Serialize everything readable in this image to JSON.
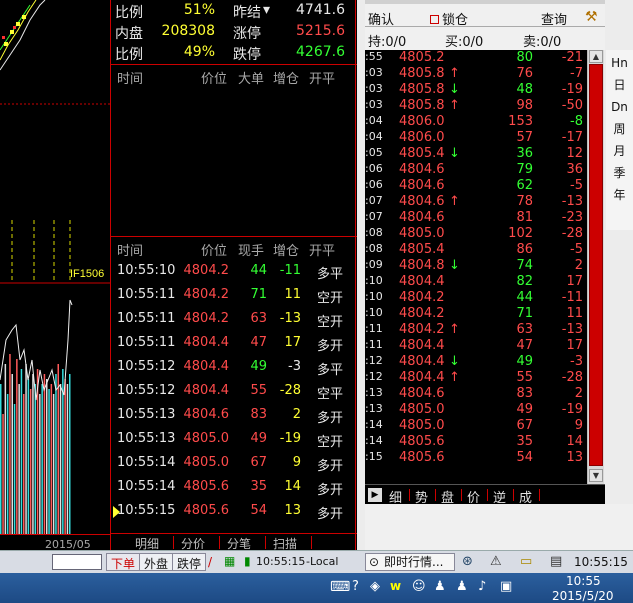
{
  "stats": [
    {
      "label": "比例",
      "value": "51%",
      "label2": "昨结",
      "value2": "4741.6",
      "v2color": "white",
      "arrow": "▾"
    },
    {
      "label": "内盘",
      "value": "208308",
      "label2": "涨停",
      "value2": "5215.6",
      "v2color": "red",
      "arrow": ""
    },
    {
      "label": "比例",
      "value": "49%",
      "label2": "跌停",
      "value2": "4267.6",
      "v2color": "green",
      "arrow": ""
    }
  ],
  "bigorder_header": {
    "time": "时间",
    "price": "价位",
    "big": "大单",
    "oi": "增仓",
    "kind": "开平"
  },
  "trades_header": {
    "time": "时间",
    "price": "价位",
    "vol": "现手",
    "oi": "增仓",
    "kind": "开平"
  },
  "trades": [
    {
      "time": "10:55:10",
      "price": "4804.2",
      "vol": "44",
      "oi": "-11",
      "kind": "多平",
      "pc": "red",
      "vc": "green",
      "oc": "green",
      "kc": "white"
    },
    {
      "time": "10:55:11",
      "price": "4804.2",
      "vol": "71",
      "oi": "11",
      "kind": "空开",
      "pc": "red",
      "vc": "green",
      "oc": "yellow",
      "kc": "white"
    },
    {
      "time": "10:55:11",
      "price": "4804.2",
      "vol": "63",
      "oi": "-13",
      "kind": "空开",
      "pc": "red",
      "vc": "red",
      "oc": "yellow",
      "kc": "white"
    },
    {
      "time": "10:55:11",
      "price": "4804.4",
      "vol": "47",
      "oi": "17",
      "kind": "多开",
      "pc": "red",
      "vc": "red",
      "oc": "yellow",
      "kc": "white"
    },
    {
      "time": "10:55:12",
      "price": "4804.4",
      "vol": "49",
      "oi": "-3",
      "kind": "多平",
      "pc": "red",
      "vc": "green",
      "oc": "white",
      "kc": "white"
    },
    {
      "time": "10:55:12",
      "price": "4804.4",
      "vol": "55",
      "oi": "-28",
      "kind": "空平",
      "pc": "red",
      "vc": "red",
      "oc": "yellow",
      "kc": "white"
    },
    {
      "time": "10:55:13",
      "price": "4804.6",
      "vol": "83",
      "oi": "2",
      "kind": "多开",
      "pc": "red",
      "vc": "red",
      "oc": "yellow",
      "kc": "white"
    },
    {
      "time": "10:55:13",
      "price": "4805.0",
      "vol": "49",
      "oi": "-19",
      "kind": "空开",
      "pc": "red",
      "vc": "red",
      "oc": "yellow",
      "kc": "white"
    },
    {
      "time": "10:55:14",
      "price": "4805.0",
      "vol": "67",
      "oi": "9",
      "kind": "多开",
      "pc": "red",
      "vc": "red",
      "oc": "yellow",
      "kc": "white"
    },
    {
      "time": "10:55:14",
      "price": "4805.6",
      "vol": "35",
      "oi": "14",
      "kind": "多开",
      "pc": "red",
      "vc": "red",
      "oc": "yellow",
      "kc": "white"
    },
    {
      "time": "10:55:15",
      "price": "4805.6",
      "vol": "54",
      "oi": "13",
      "kind": "多开",
      "pc": "red",
      "vc": "red",
      "oc": "yellow",
      "kc": "white"
    }
  ],
  "mid_tabs": [
    "明细",
    "分价",
    "分笔",
    "扫描"
  ],
  "chart": {
    "contract": "IF1506",
    "date": "2015/05"
  },
  "trade_panel": {
    "confirm": "确认",
    "lock": "锁仓",
    "query": "查询",
    "hold": "持:0/0",
    "buy": "买:0/0",
    "sell": "卖:0/0"
  },
  "ticks": [
    {
      "t": ":55",
      "p": "4805.2",
      "a": "",
      "v": "80",
      "o": "-21",
      "vc": "green",
      "oc": "red"
    },
    {
      "t": ":03",
      "p": "4805.8",
      "a": "↑",
      "v": "76",
      "o": "-7",
      "vc": "red",
      "oc": "red"
    },
    {
      "t": ":03",
      "p": "4805.8",
      "a": "↓",
      "v": "48",
      "o": "-19",
      "vc": "green",
      "oc": "red"
    },
    {
      "t": ":03",
      "p": "4805.8",
      "a": "↑",
      "v": "98",
      "o": "-50",
      "vc": "red",
      "oc": "red"
    },
    {
      "t": ":04",
      "p": "4806.0",
      "a": "",
      "v": "153",
      "o": "-8",
      "vc": "red",
      "oc": "green"
    },
    {
      "t": ":04",
      "p": "4806.0",
      "a": "",
      "v": "57",
      "o": "-17",
      "vc": "red",
      "oc": "red"
    },
    {
      "t": ":05",
      "p": "4805.4",
      "a": "↓",
      "v": "36",
      "o": "12",
      "vc": "green",
      "oc": "red"
    },
    {
      "t": ":06",
      "p": "4804.6",
      "a": "",
      "v": "79",
      "o": "36",
      "vc": "green",
      "oc": "red"
    },
    {
      "t": ":06",
      "p": "4804.6",
      "a": "",
      "v": "62",
      "o": "-5",
      "vc": "green",
      "oc": "red"
    },
    {
      "t": ":07",
      "p": "4804.6",
      "a": "↑",
      "v": "78",
      "o": "-13",
      "vc": "red",
      "oc": "red"
    },
    {
      "t": ":07",
      "p": "4804.6",
      "a": "",
      "v": "81",
      "o": "-23",
      "vc": "red",
      "oc": "red"
    },
    {
      "t": ":08",
      "p": "4805.0",
      "a": "",
      "v": "102",
      "o": "-28",
      "vc": "red",
      "oc": "red"
    },
    {
      "t": ":08",
      "p": "4805.4",
      "a": "",
      "v": "86",
      "o": "-5",
      "vc": "red",
      "oc": "red"
    },
    {
      "t": ":09",
      "p": "4804.8",
      "a": "↓",
      "v": "74",
      "o": "2",
      "vc": "green",
      "oc": "red"
    },
    {
      "t": ":10",
      "p": "4804.4",
      "a": "",
      "v": "82",
      "o": "17",
      "vc": "green",
      "oc": "red"
    },
    {
      "t": ":10",
      "p": "4804.2",
      "a": "",
      "v": "44",
      "o": "-11",
      "vc": "green",
      "oc": "red"
    },
    {
      "t": ":10",
      "p": "4804.2",
      "a": "",
      "v": "71",
      "o": "11",
      "vc": "green",
      "oc": "red"
    },
    {
      "t": ":11",
      "p": "4804.2",
      "a": "↑",
      "v": "63",
      "o": "-13",
      "vc": "red",
      "oc": "red"
    },
    {
      "t": ":11",
      "p": "4804.4",
      "a": "",
      "v": "47",
      "o": "17",
      "vc": "red",
      "oc": "red"
    },
    {
      "t": ":12",
      "p": "4804.4",
      "a": "↓",
      "v": "49",
      "o": "-3",
      "vc": "green",
      "oc": "red"
    },
    {
      "t": ":12",
      "p": "4804.4",
      "a": "↑",
      "v": "55",
      "o": "-28",
      "vc": "red",
      "oc": "red"
    },
    {
      "t": ":13",
      "p": "4804.6",
      "a": "",
      "v": "83",
      "o": "2",
      "vc": "red",
      "oc": "red"
    },
    {
      "t": ":13",
      "p": "4805.0",
      "a": "",
      "v": "49",
      "o": "-19",
      "vc": "red",
      "oc": "red"
    },
    {
      "t": ":14",
      "p": "4805.0",
      "a": "",
      "v": "67",
      "o": "9",
      "vc": "red",
      "oc": "red"
    },
    {
      "t": ":14",
      "p": "4805.6",
      "a": "",
      "v": "35",
      "o": "14",
      "vc": "red",
      "oc": "red"
    },
    {
      "t": ":15",
      "p": "4805.6",
      "a": "",
      "v": "54",
      "o": "13",
      "vc": "red",
      "oc": "red"
    }
  ],
  "tick_tabs": [
    "细",
    "势",
    "盘",
    "价",
    "逆",
    "成"
  ],
  "period_buttons": [
    "Hn",
    "日",
    "Dn",
    "周",
    "月",
    "季",
    "年"
  ],
  "taskbar": {
    "app_item": "即时行情...",
    "clock_small": "10:55:15",
    "clock": "10:55",
    "date": "2015/5/20",
    "btn_buy": "下单",
    "btn_out": "外盘",
    "btn_drop": "跌停",
    "clock_left": "10:55:15"
  }
}
